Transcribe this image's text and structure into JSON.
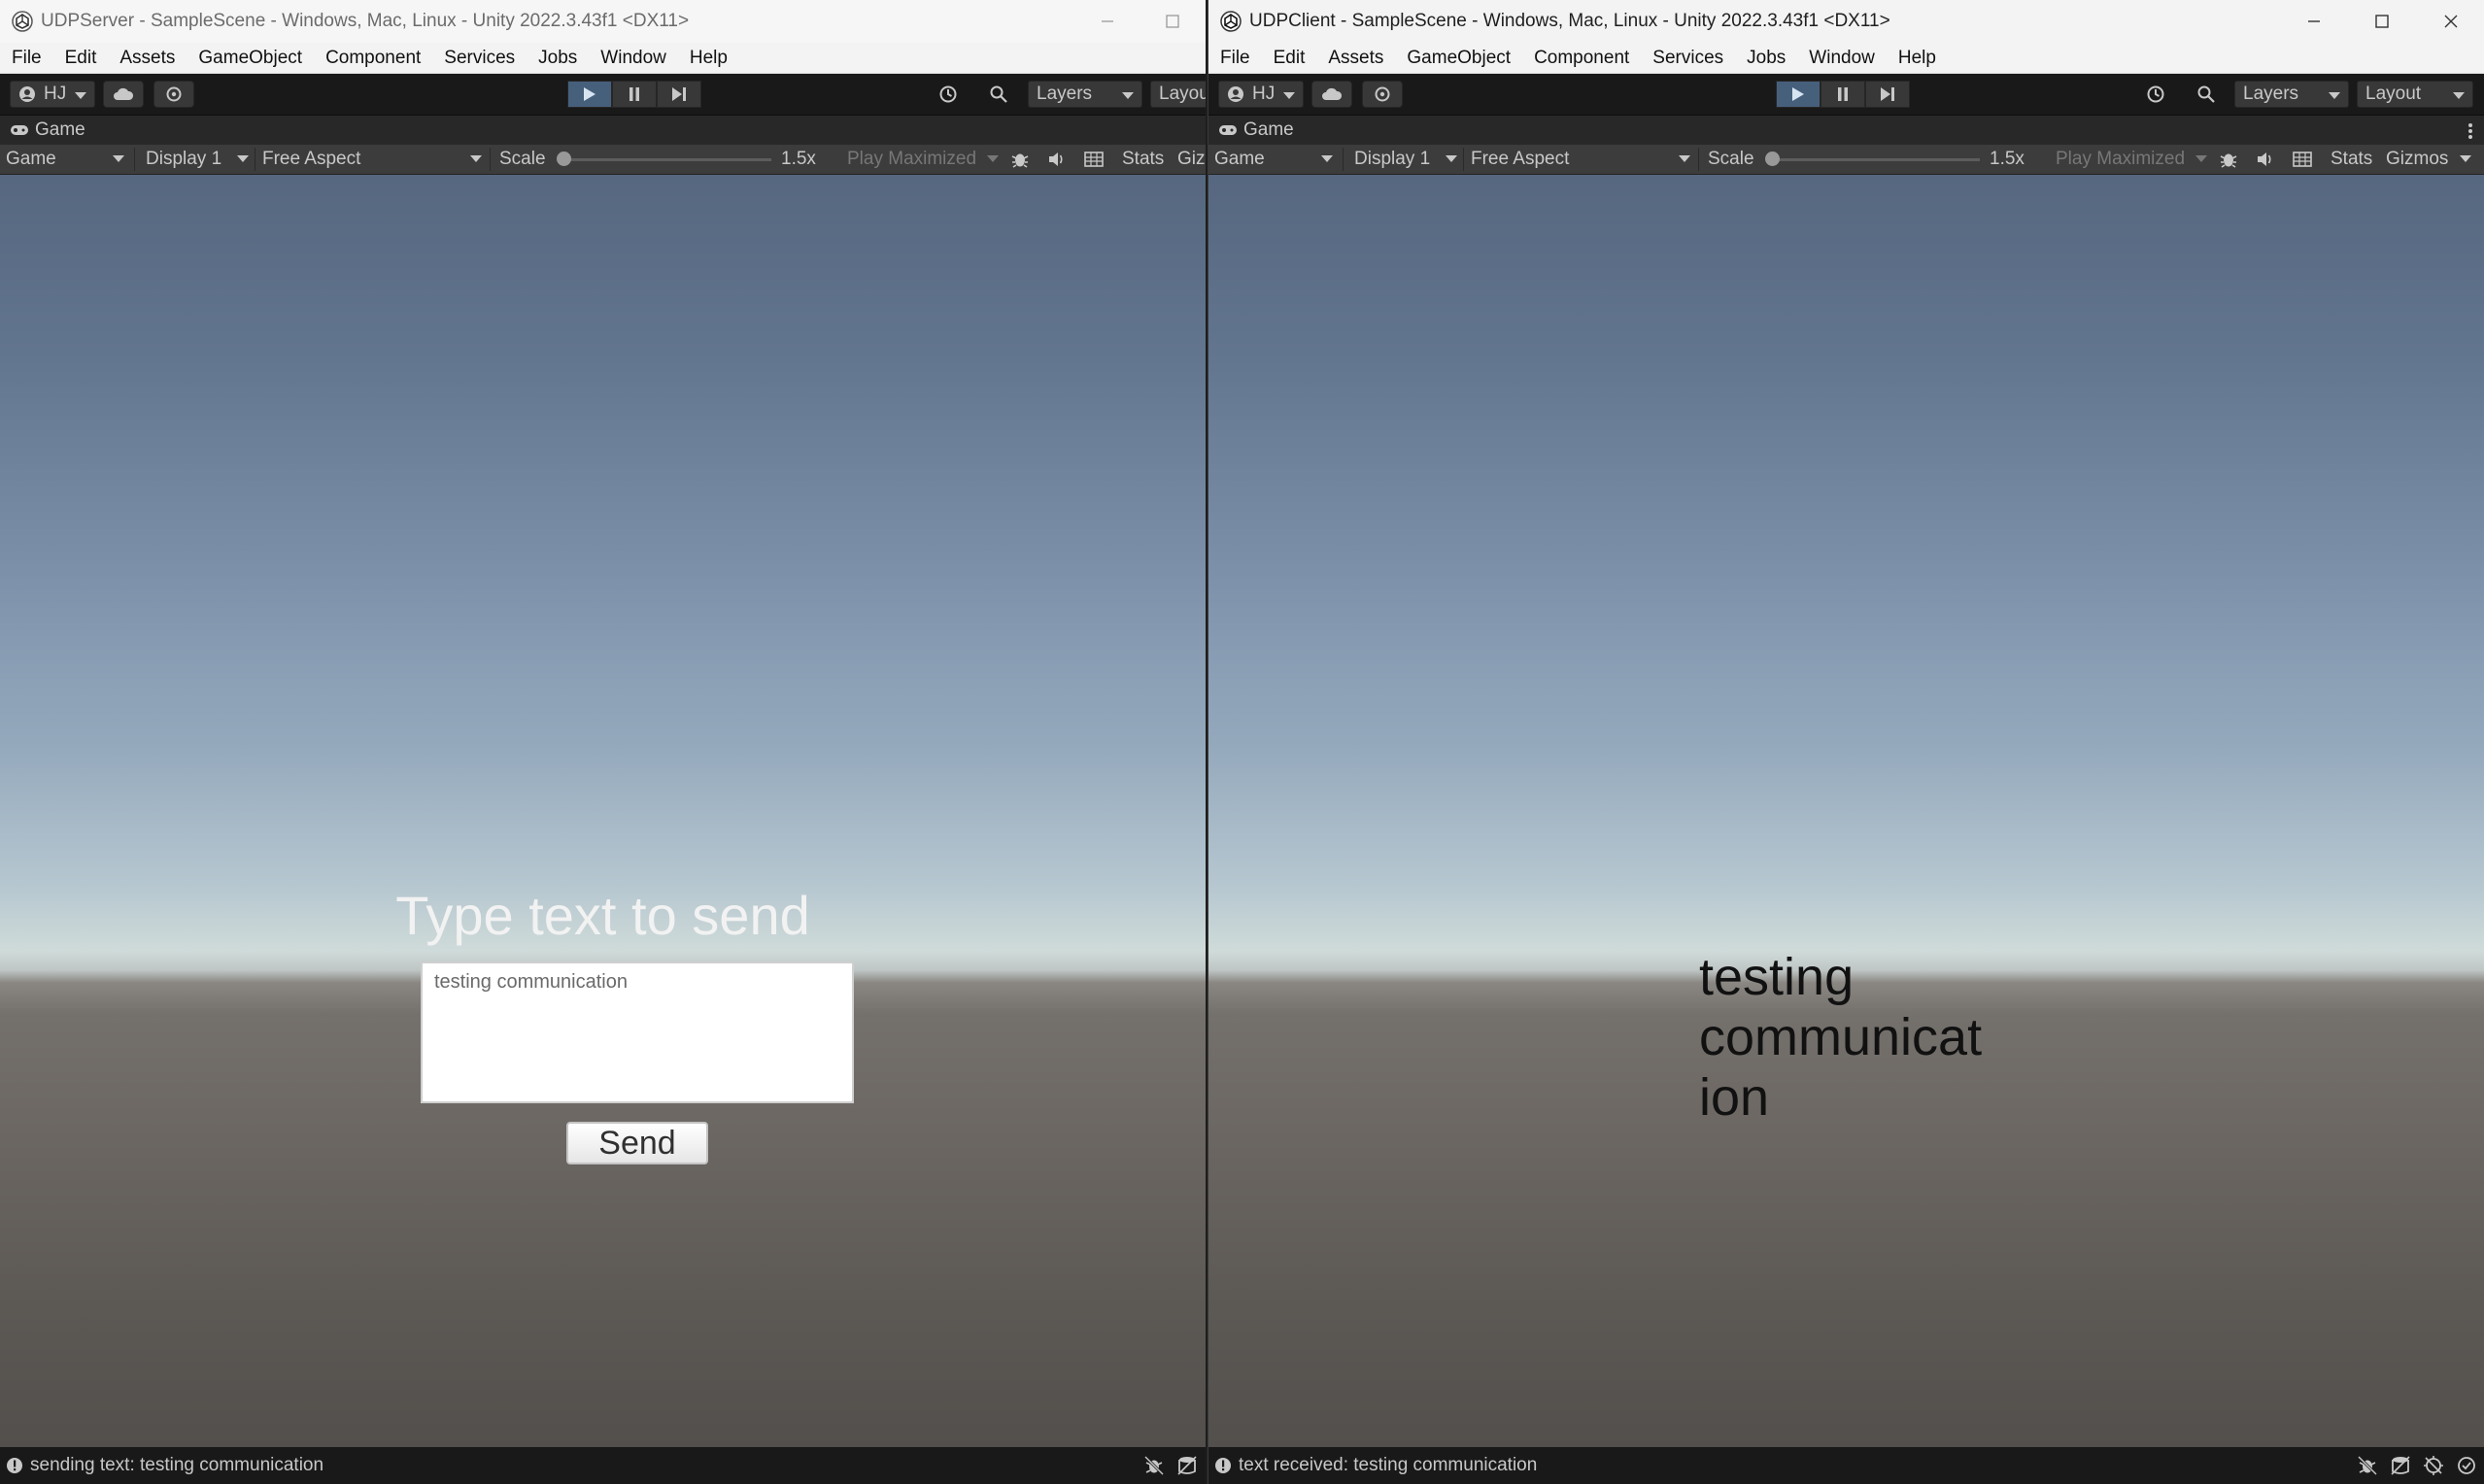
{
  "server": {
    "window_title": "UDPServer - SampleScene - Windows, Mac, Linux - Unity 2022.3.43f1 <DX11>",
    "menu": [
      "File",
      "Edit",
      "Assets",
      "GameObject",
      "Component",
      "Services",
      "Jobs",
      "Window",
      "Help"
    ],
    "account_label": "HJ",
    "layers_label": "Layers",
    "layout_label": "Layout",
    "tab_label": "Game",
    "game_view": {
      "mode": "Game",
      "display": "Display 1",
      "aspect": "Free Aspect",
      "scale_label": "Scale",
      "scale_value": "1.5x",
      "play_maximized": "Play Maximized",
      "stats": "Stats",
      "gizmos": "Giz"
    },
    "scene": {
      "prompt": "Type text to send",
      "input_value": "testing communication",
      "send_label": "Send"
    },
    "status": "sending text: testing communication"
  },
  "client": {
    "window_title": "UDPClient - SampleScene - Windows, Mac, Linux - Unity 2022.3.43f1 <DX11>",
    "menu": [
      "File",
      "Edit",
      "Assets",
      "GameObject",
      "Component",
      "Services",
      "Jobs",
      "Window",
      "Help"
    ],
    "account_label": "HJ",
    "layers_label": "Layers",
    "layout_label": "Layout",
    "tab_label": "Game",
    "game_view": {
      "mode": "Game",
      "display": "Display 1",
      "aspect": "Free Aspect",
      "scale_label": "Scale",
      "scale_value": "1.5x",
      "play_maximized": "Play Maximized",
      "stats": "Stats",
      "gizmos": "Gizmos"
    },
    "scene": {
      "received_text": "testing\ncommunicat\nion"
    },
    "status": "text received: testing communication"
  },
  "colors": {
    "play_active": "#46607c",
    "toolbar_bg": "#191919",
    "sky_top": "#56677f",
    "horizon": "#cfdbd9",
    "ground": "#6c6763"
  }
}
